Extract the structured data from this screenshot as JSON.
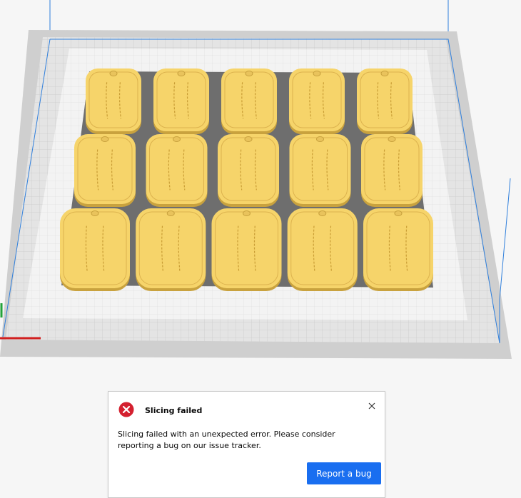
{
  "viewport": {
    "tag_rows": 3,
    "tags_per_row": 5,
    "colors": {
      "background": "#f6f6f6",
      "build_plate": "#e4e4e4",
      "bed_border": "#cfcfcf",
      "print_area": "#f3f3f3",
      "shadow": "#6e6e6e",
      "model": "#f6d46a",
      "model_edge": "#c9a23e",
      "volume_edge": "#2f7fdc",
      "axis_x": "#d11f1f",
      "axis_y": "#23a339"
    }
  },
  "notification": {
    "icon": "error-circle-icon",
    "icon_color": "#d4202f",
    "title": "Slicing failed",
    "message": "Slicing failed with an unexpected error. Please consider reporting a bug on our issue tracker.",
    "close_icon": "close-icon",
    "button_label": "Report a bug",
    "button_color": "#196ef0"
  }
}
